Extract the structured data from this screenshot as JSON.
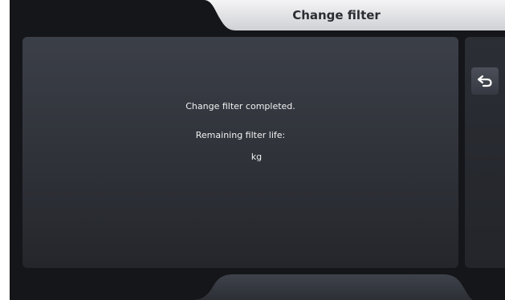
{
  "header": {
    "title": "Change filter"
  },
  "message": {
    "line1": "Change filter completed.",
    "line2": "Remaining filter life:",
    "unit": "kg"
  },
  "sidebar": {
    "back_icon": "return-arrow-icon"
  },
  "colors": {
    "background": "#151619",
    "panel": "#34373f",
    "title_tab": "#e6e7e9",
    "text": "#f2f2f2"
  }
}
